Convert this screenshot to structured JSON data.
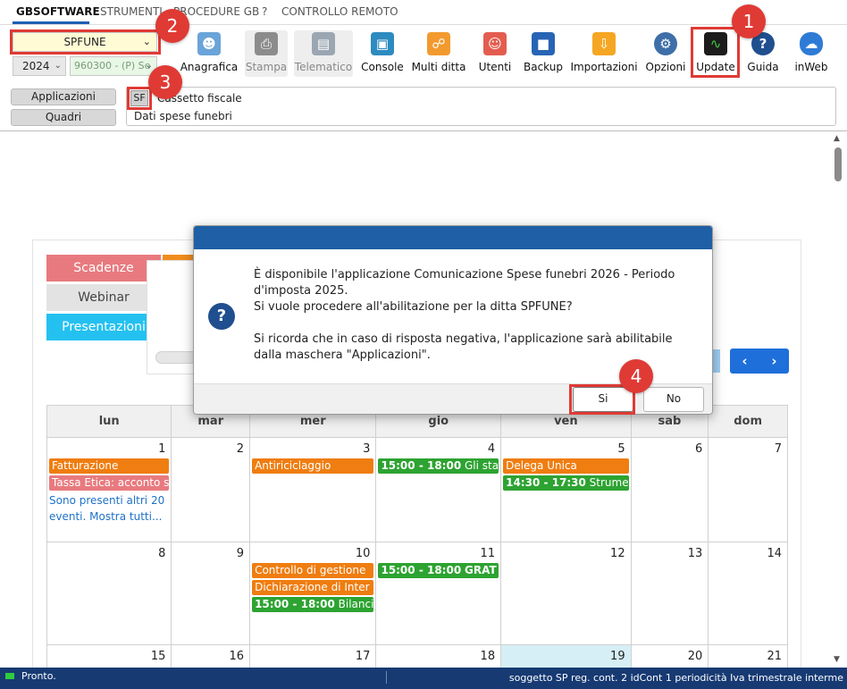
{
  "menu": {
    "items": [
      "GBSOFTWARE",
      "STRUMENTI",
      "PROCEDURE GB",
      "?",
      "CONTROLLO REMOTO"
    ]
  },
  "company": {
    "selected": "SPFUNE",
    "year": "2024",
    "code": "960300 - (P) Se"
  },
  "toolbar": {
    "tools": [
      {
        "label": "Anagrafica",
        "icon": "id-card-icon",
        "color": "#6aa4d8"
      },
      {
        "label": "Stampa",
        "icon": "printer-icon",
        "color": "#8c8c8c"
      },
      {
        "label": "Telematico",
        "icon": "document-icon",
        "color": "#9aa6b2"
      },
      {
        "label": "Console",
        "icon": "console-icon",
        "color": "#2e8bc0"
      },
      {
        "label": "Multi ditta",
        "icon": "network-icon",
        "color": "#f29a2e"
      },
      {
        "label": "Utenti",
        "icon": "users-icon",
        "color": "#e35d4f"
      },
      {
        "label": "Backup",
        "icon": "disk-icon",
        "color": "#2864b4"
      },
      {
        "label": "Importazioni",
        "icon": "import-icon",
        "color": "#f5a623"
      },
      {
        "label": "Opzioni",
        "icon": "gear-icon",
        "color": "#3f6fa8"
      },
      {
        "label": "Update",
        "icon": "monitor-icon",
        "color": "#1c1c1c"
      },
      {
        "label": "Guida",
        "icon": "help-icon",
        "color": "#1f4f8f"
      },
      {
        "label": "inWeb",
        "icon": "cloud-icon",
        "color": "#2e7bd6"
      }
    ]
  },
  "nav": {
    "applicazioni": "Applicazioni",
    "quadri": "Quadri",
    "sf": "SF",
    "line1": "Cassetto fiscale",
    "line2": "Dati spese funebri"
  },
  "widget": {
    "tabs": [
      "Scadenze",
      "Webinar",
      "Presentazioni"
    ],
    "nav_prev": "‹",
    "nav_next": "›"
  },
  "calendar": {
    "weekdays": [
      "lun",
      "mar",
      "mer",
      "gio",
      "ven",
      "sab",
      "dom"
    ],
    "week1": {
      "days": [
        "1",
        "2",
        "3",
        "4",
        "5",
        "6",
        "7"
      ],
      "d1_ev1": "Fatturazione",
      "d1_ev2": "Tassa Etica: acconto s",
      "d1_more": "Sono presenti altri 20 eventi. Mostra tutti...",
      "d3_ev1": "Antiriciclaggio",
      "d4_time": "15:00 - 18:00",
      "d4_title": "Gli sta",
      "d5_ev1": "Delega Unica",
      "d5_time": "14:30 - 17:30",
      "d5_title": "Strume"
    },
    "week2": {
      "days": [
        "8",
        "9",
        "10",
        "11",
        "12",
        "13",
        "14"
      ],
      "d10_ev1": "Controllo di gestione",
      "d10_ev2": "Dichiarazione di Inter",
      "d10_time": "15:00 - 18:00",
      "d10_title": "Bilanci",
      "d11_time": "15:00 - 18:00",
      "d11_title": "GRAT"
    },
    "week3": {
      "days": [
        "15",
        "16",
        "17",
        "18",
        "19",
        "20",
        "21"
      ]
    }
  },
  "dialog": {
    "line1": "È disponibile l'applicazione Comunicazione Spese funebri 2026 - Periodo d'imposta 2025.",
    "line2": "Si vuole procedere all'abilitazione per la ditta SPFUNE?",
    "line3": "Si ricorda che in caso di risposta negativa, l'applicazione sarà abilitabile dalla maschera \"Applicazioni\".",
    "yes": "Si",
    "no": "No"
  },
  "status": {
    "left": "Pronto.",
    "right": "soggetto SP reg. cont. 2 idCont 1 periodicità Iva trimestrale interme"
  },
  "annotations": [
    "1",
    "2",
    "3",
    "4"
  ],
  "colors": {
    "annotation_red": "#e03a35",
    "status_bar": "#173a73",
    "dialog_header": "#1f5fa5"
  }
}
